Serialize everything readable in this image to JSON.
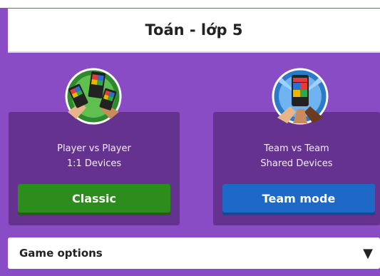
{
  "header": {
    "title": "Toán - lớp 5"
  },
  "modes": [
    {
      "line1": "Player vs Player",
      "line2": "1:1 Devices",
      "button_label": "Classic",
      "icon": "player-vs-player-icon",
      "color": "#2c8c1c"
    },
    {
      "line1": "Team vs Team",
      "line2": "Shared Devices",
      "button_label": "Team mode",
      "icon": "team-vs-team-icon",
      "color": "#1e68c8"
    }
  ],
  "options": {
    "label": "Game options",
    "icon": "dropdown-triangle-icon"
  },
  "colors": {
    "background": "#8a4cc4",
    "card": "#66328f"
  }
}
